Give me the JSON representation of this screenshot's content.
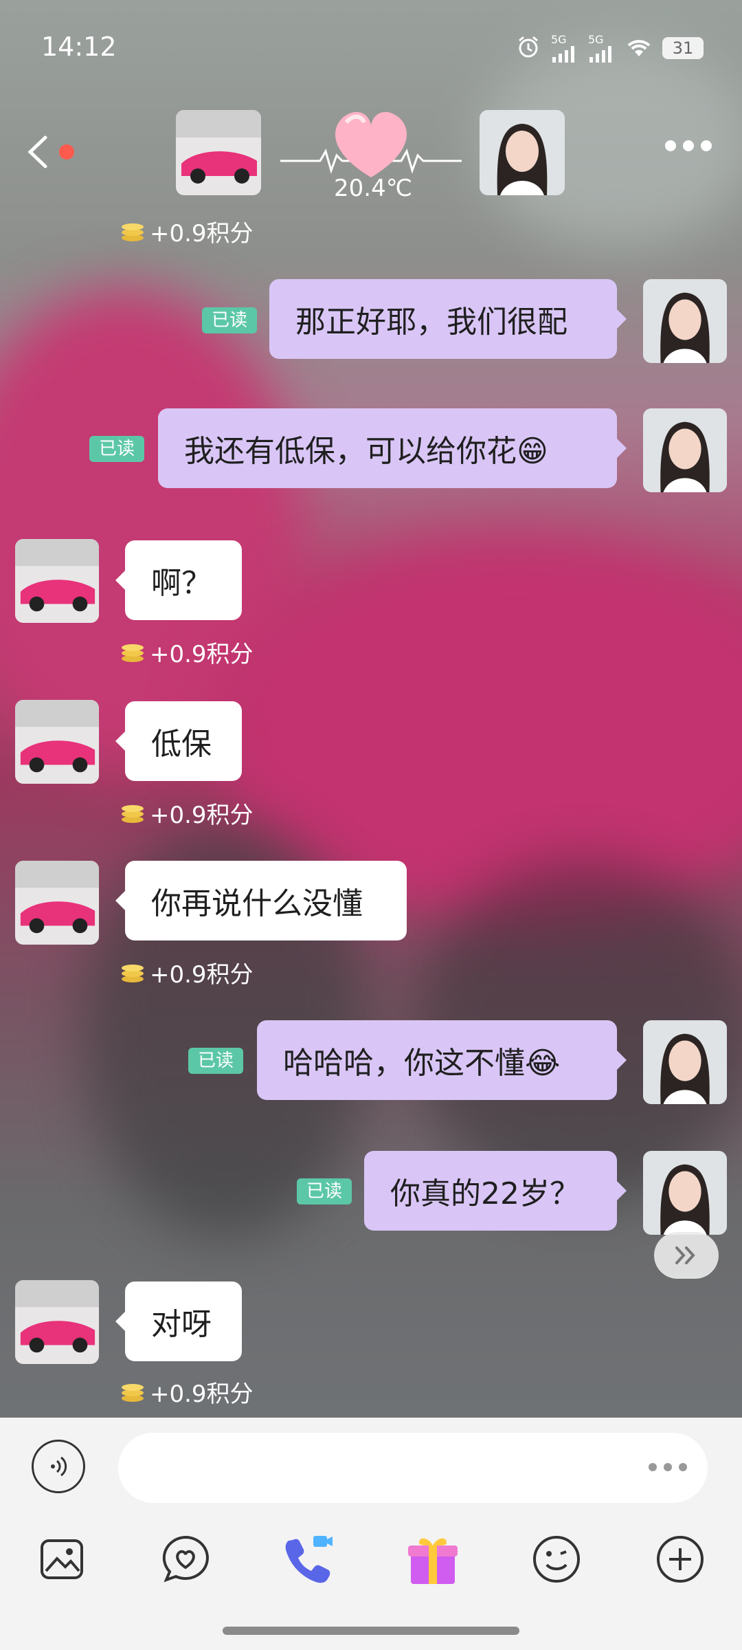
{
  "status": {
    "time": "14:12",
    "net1": "5G",
    "net2": "5G",
    "battery": "31"
  },
  "header": {
    "temperature": "20.4℃",
    "avatar_left": "car-avatar",
    "avatar_right": "girl-avatar"
  },
  "messages": [
    {
      "dir": "out",
      "text": "那正好耶，我们很配",
      "read": "已读"
    },
    {
      "dir": "out",
      "text": "我还有低保，可以给你花😁",
      "read": "已读"
    },
    {
      "dir": "in",
      "text": "啊？",
      "points": "+0.9积分"
    },
    {
      "dir": "in",
      "text": "低保",
      "points": "+0.9积分"
    },
    {
      "dir": "in",
      "text": "你再说什么没懂",
      "points": "+0.9积分"
    },
    {
      "dir": "out",
      "text": "哈哈哈，你这不懂😂",
      "read": "已读"
    },
    {
      "dir": "out",
      "text": "你真的22岁？",
      "read": "已读"
    },
    {
      "dir": "in",
      "text": "对呀",
      "points": "+0.9积分"
    }
  ],
  "top_points": "+0.9积分",
  "colors": {
    "out_bubble": "#d9c6f6",
    "in_bubble": "#ffffff",
    "read_badge": "#5cc7a7",
    "notify_dot": "#ff5a4e"
  },
  "toolbar": [
    "image-icon",
    "heart-chat-icon",
    "video-call-icon",
    "gift-icon",
    "emoji-icon",
    "plus-icon"
  ]
}
